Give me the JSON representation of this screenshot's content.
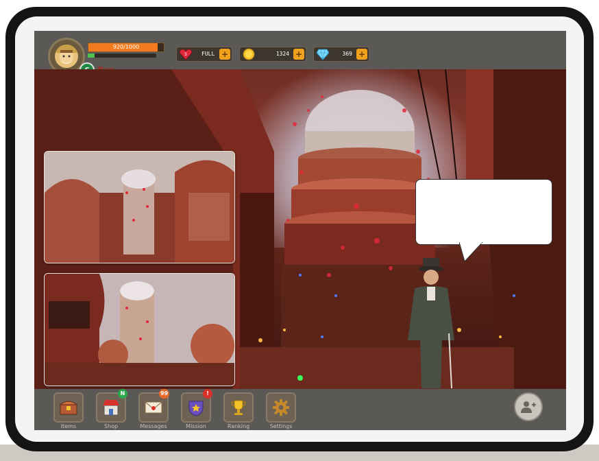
{
  "player": {
    "xp_text": "920/1000",
    "xp_fraction": 0.92,
    "level": "6",
    "name": "Bau"
  },
  "resources": [
    {
      "name": "energy",
      "icon": "heart-icon",
      "value": "FULL",
      "icon_text": "5"
    },
    {
      "name": "coins",
      "icon": "coin-icon",
      "value": "1324"
    },
    {
      "name": "gems",
      "icon": "diamond-icon",
      "value": "369"
    }
  ],
  "plus_label": "+",
  "speech_bubble": {
    "text": ""
  },
  "nav": [
    {
      "label": "Items",
      "icon": "treasure-chest-icon",
      "badge": ""
    },
    {
      "label": "Shop",
      "icon": "shop-icon",
      "badge": "N"
    },
    {
      "label": "Messages",
      "icon": "envelope-icon",
      "badge": "99"
    },
    {
      "label": "Mission",
      "icon": "mission-shield-icon",
      "badge": "!"
    },
    {
      "label": "Ranking",
      "icon": "trophy-icon",
      "badge": ""
    },
    {
      "label": "Settings",
      "icon": "gear-icon",
      "badge": ""
    }
  ],
  "colors": {
    "accent_orange": "#f0a21f",
    "xp_fill": "#f27b1f",
    "level_green": "#1c8a42",
    "badge_green": "#2aa84a",
    "badge_orange": "#e8682a",
    "badge_red": "#d9302a"
  }
}
